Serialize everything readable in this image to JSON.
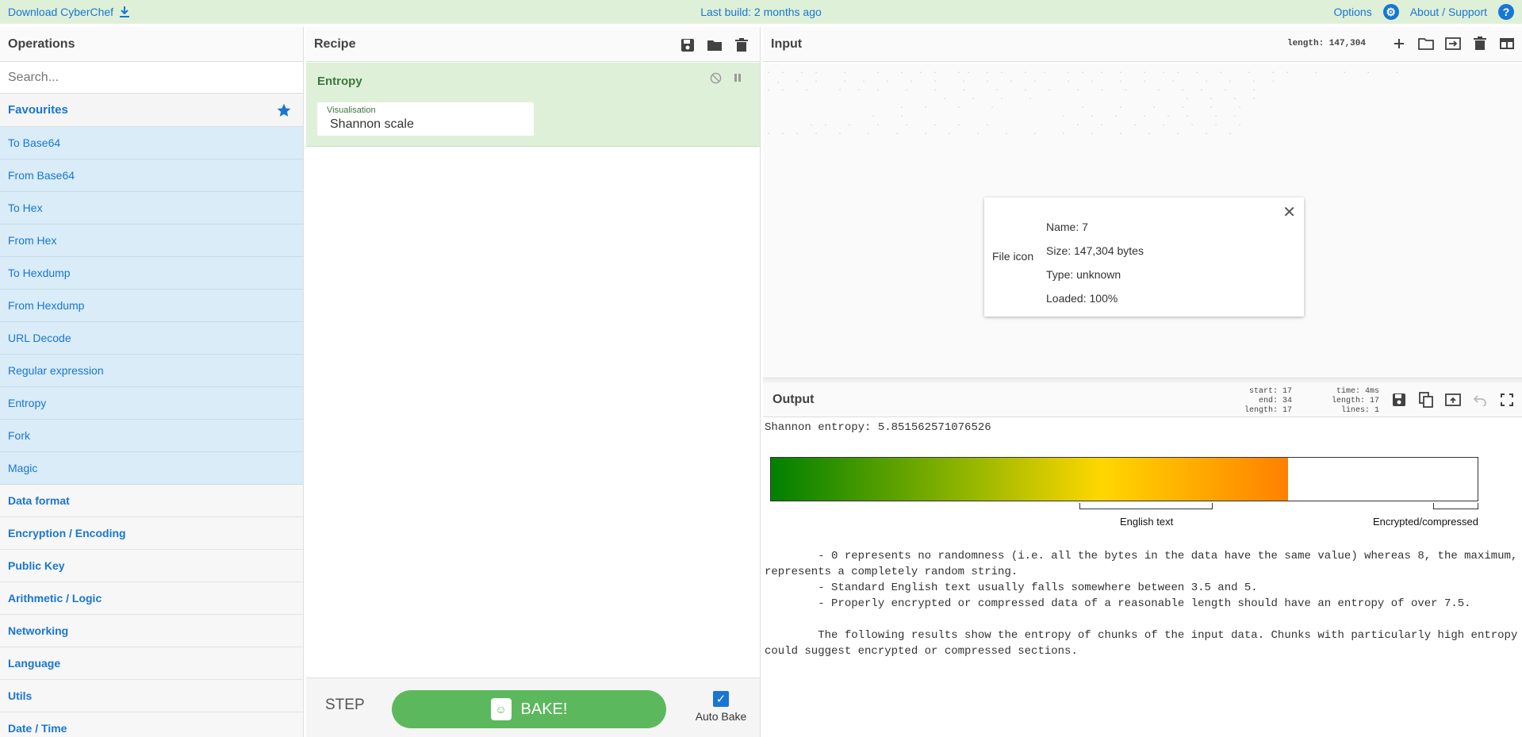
{
  "banner": {
    "download": "Download CyberChef",
    "last_build": "Last build: 2 months ago",
    "options": "Options",
    "about": "About / Support"
  },
  "operations": {
    "title": "Operations",
    "search_placeholder": "Search...",
    "favourites": "Favourites",
    "items": [
      "To Base64",
      "From Base64",
      "To Hex",
      "From Hex",
      "To Hexdump",
      "From Hexdump",
      "URL Decode",
      "Regular expression",
      "Entropy",
      "Fork",
      "Magic"
    ],
    "categories": [
      "Data format",
      "Encryption / Encoding",
      "Public Key",
      "Arithmetic / Logic",
      "Networking",
      "Language",
      "Utils",
      "Date / Time"
    ]
  },
  "recipe": {
    "title": "Recipe",
    "operation": {
      "name": "Entropy",
      "field_label": "Visualisation",
      "field_value": "Shannon scale"
    },
    "step_label": "STEP",
    "bake_label": "BAKE!",
    "autobake_label": "Auto Bake",
    "autobake_checked": true
  },
  "input": {
    "title": "Input",
    "length": "length: 147,304",
    "file": {
      "icon_text": "File icon",
      "name": "Name: 7",
      "size": "Size: 147,304 bytes",
      "type": "Type: unknown",
      "loaded": "Loaded: 100%"
    }
  },
  "output": {
    "title": "Output",
    "stats": {
      "start": "start: 17",
      "end": "end: 34",
      "length": "length: 17",
      "time": "time: 4ms",
      "length2": "length: 17",
      "lines": "lines: 1"
    },
    "entropy_line": "Shannon entropy: 5.851562571076526",
    "entropy_value": 5.851562571076526,
    "scale_max": 8,
    "english_label": "English text",
    "encrypted_label": "Encrypted/compressed",
    "description": "\t- 0 represents no randomness (i.e. all the bytes in the data have the same value) whereas 8, the maximum,\nrepresents a completely random string.\n\t- Standard English text usually falls somewhere between 3.5 and 5.\n\t- Properly encrypted or compressed data of a reasonable length should have an entropy of over 7.5.\n\n\tThe following results show the entropy of chunks of the input data. Chunks with particularly high entropy\ncould suggest encrypted or compressed sections."
  },
  "colors": {
    "accent": "#1976d2",
    "banner_bg": "#dff0d8",
    "op_highlight": "#d9ecf7",
    "bake_green": "#5cb85c"
  }
}
